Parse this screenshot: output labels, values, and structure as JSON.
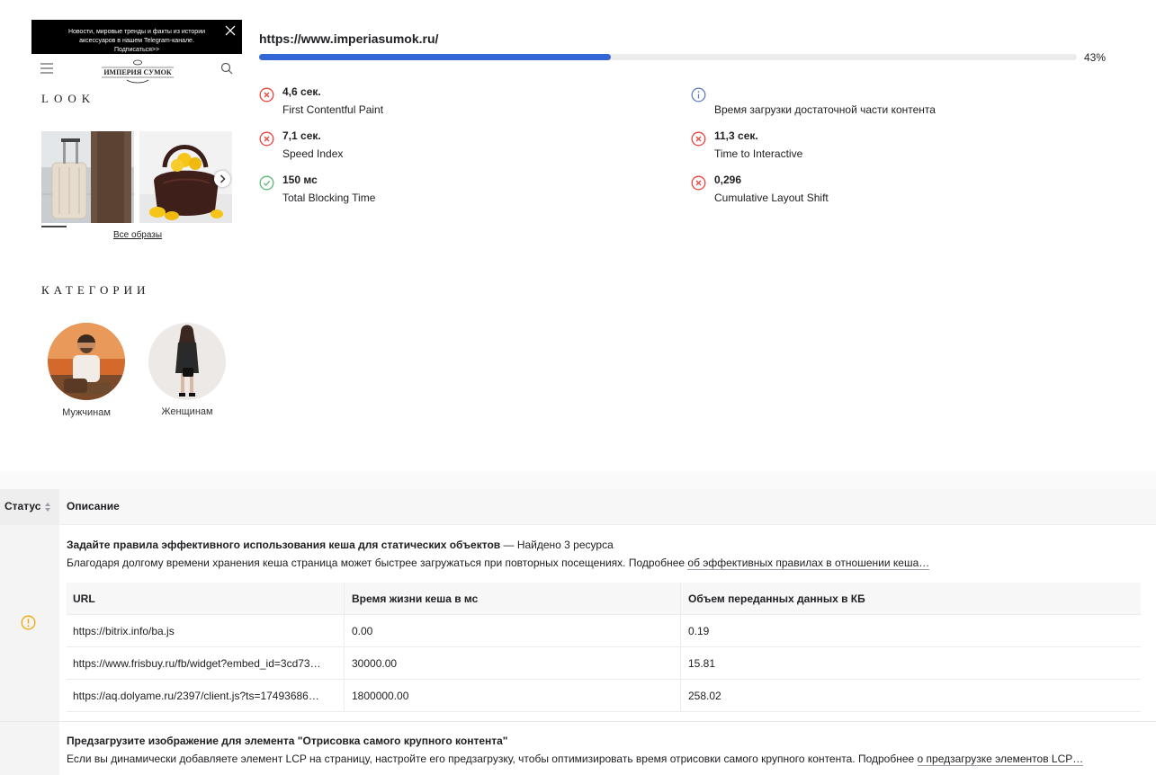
{
  "preview": {
    "promo_text": "Новости, мировые тренды и факты из истории аксессуаров в нашем Telegram-канале. Подписаться>>",
    "logo_text": "ИМПЕРИЯ СУМОК",
    "look_title": "LOOK",
    "all_looks_link": "Все образы",
    "categories_title": "КАТЕГОРИИ",
    "categories": [
      {
        "label": "Мужчинам"
      },
      {
        "label": "Женщинам"
      }
    ]
  },
  "report": {
    "url": "https://www.imperiasumok.ru/",
    "progress_label": "43%",
    "progress_fraction": 0.43
  },
  "metrics": [
    {
      "status": "fail",
      "icon": "error-circle-icon",
      "value": "4,6 сек.",
      "name": "First Contentful Paint"
    },
    {
      "status": "info",
      "icon": "info-circle-icon",
      "value": "",
      "name": "Время загрузки достаточной части контента"
    },
    {
      "status": "fail",
      "icon": "error-circle-icon",
      "value": "7,1 сек.",
      "name": "Speed Index"
    },
    {
      "status": "fail",
      "icon": "error-circle-icon",
      "value": "11,3 сек.",
      "name": "Time to Interactive"
    },
    {
      "status": "pass",
      "icon": "check-circle-icon",
      "value": "150 мс",
      "name": "Total Blocking Time"
    },
    {
      "status": "fail",
      "icon": "error-circle-icon",
      "value": "0,296",
      "name": "Cumulative Layout Shift"
    }
  ],
  "colors": {
    "fail": "#e8453c",
    "pass": "#5bb974",
    "info": "#5f7fbf",
    "warn": "#f2a600",
    "progress": "#3367d6"
  },
  "table": {
    "col_status": "Статус",
    "col_description": "Описание",
    "audits": [
      {
        "status": "warn",
        "title": "Задайте правила эффективного использования кеша для статических объектов",
        "title_suffix": " — Найдено 3 ресурса",
        "description": "Благодаря долгому времени хранения кеша страница может быстрее загружаться при повторных посещениях. Подробнее ",
        "link_text": "об эффективных правилах в отношении кеша…",
        "details": {
          "headers": [
            "URL",
            "Время жизни кеша в мс",
            "Объем переданных данных в КБ"
          ],
          "rows": [
            [
              "https://bitrix.info/ba.js",
              "0.00",
              "0.19"
            ],
            [
              "https://www.frisbuy.ru/fb/widget?embed_id=3cd73…",
              "30000.00",
              "15.81"
            ],
            [
              "https://aq.dolyame.ru/2397/client.js?ts=17493686…",
              "1800000.00",
              "258.02"
            ]
          ]
        }
      },
      {
        "title": "Предзагрузите изображение для элемента \"Отрисовка самого крупного контента\"",
        "description": "Если вы динамически добавляете элемент LCP на страницу, настройте его предзагрузку, чтобы оптимизировать время отрисовки самого крупного контента. Подробнее ",
        "link_text": "о предзагрузке элементов LCP…"
      }
    ]
  }
}
